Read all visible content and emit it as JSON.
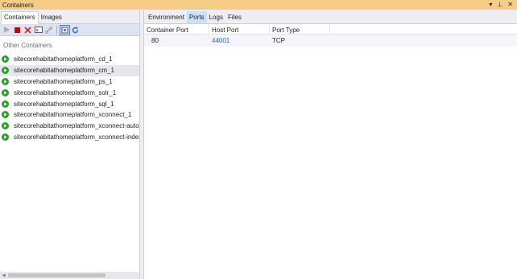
{
  "window": {
    "title": "Containers",
    "controls": {
      "dropdown": "▾",
      "pin": "⊥",
      "close": "✕"
    }
  },
  "left": {
    "tabs": [
      {
        "label": "Containers",
        "active": true
      },
      {
        "label": "Images",
        "active": false
      }
    ],
    "toolbar": [
      "start-icon",
      "stop-icon",
      "delete-icon",
      "terminal-icon",
      "attach-icon",
      "prune-icon",
      "refresh-icon"
    ],
    "section_label": "Other Containers",
    "containers": [
      {
        "name": "sitecorehabitathomeplatform_cd_1",
        "selected": false
      },
      {
        "name": "sitecorehabitathomeplatform_cm_1",
        "selected": true
      },
      {
        "name": "sitecorehabitathomeplatform_ps_1",
        "selected": false
      },
      {
        "name": "sitecorehabitathomeplatform_solr_1",
        "selected": false
      },
      {
        "name": "sitecorehabitathomeplatform_sql_1",
        "selected": false
      },
      {
        "name": "sitecorehabitathomeplatform_xconnect_1",
        "selected": false
      },
      {
        "name": "sitecorehabitathomeplatform_xconnect-automa",
        "selected": false
      },
      {
        "name": "sitecorehabitathomeplatform_xconnect-indexw",
        "selected": false
      }
    ]
  },
  "right": {
    "tabs": [
      {
        "label": "Environment",
        "active": false
      },
      {
        "label": "Ports",
        "active": true
      },
      {
        "label": "Logs",
        "active": false
      },
      {
        "label": "Files",
        "active": false
      }
    ],
    "columns": [
      "Container Port",
      "Host Port",
      "Port Type"
    ],
    "rows": [
      {
        "container_port": "80",
        "host_port": "44001",
        "port_type": "TCP"
      }
    ]
  },
  "colors": {
    "titlebar": "#f5cc84",
    "link": "#1e6cc7",
    "run_green": "#2e9b2e",
    "stop_red": "#c4302b"
  }
}
